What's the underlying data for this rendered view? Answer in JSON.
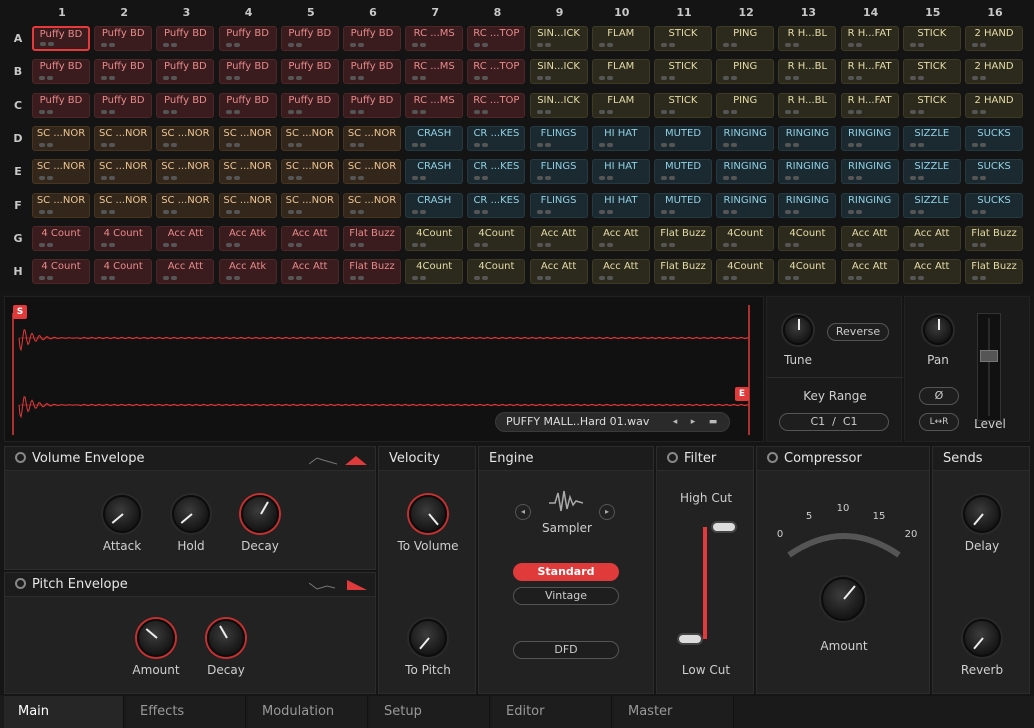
{
  "grid": {
    "columns": [
      "1",
      "2",
      "3",
      "4",
      "5",
      "6",
      "7",
      "8",
      "9",
      "10",
      "11",
      "12",
      "13",
      "14",
      "15",
      "16"
    ],
    "rows": [
      {
        "label": "A",
        "cells": [
          "Puffy BD",
          "Puffy BD",
          "Puffy BD",
          "Puffy BD",
          "Puffy BD",
          "Puffy BD",
          "RC ...MS",
          "RC ...TOP",
          "SIN...ICK",
          "FLAM",
          "STICK",
          "PING",
          "R H...BL",
          "R H...FAT",
          "STICK",
          "2 HAND"
        ]
      },
      {
        "label": "B",
        "cells": [
          "Puffy BD",
          "Puffy BD",
          "Puffy BD",
          "Puffy BD",
          "Puffy BD",
          "Puffy BD",
          "RC ...MS",
          "RC ...TOP",
          "SIN...ICK",
          "FLAM",
          "STICK",
          "PING",
          "R H...BL",
          "R H...FAT",
          "STICK",
          "2 HAND"
        ]
      },
      {
        "label": "C",
        "cells": [
          "Puffy BD",
          "Puffy BD",
          "Puffy BD",
          "Puffy BD",
          "Puffy BD",
          "Puffy BD",
          "RC ...MS",
          "RC ...TOP",
          "SIN...ICK",
          "FLAM",
          "STICK",
          "PING",
          "R H...BL",
          "R H...FAT",
          "STICK",
          "2 HAND"
        ]
      },
      {
        "label": "D",
        "cells": [
          "SC ...NOR",
          "SC ...NOR",
          "SC ...NOR",
          "SC ...NOR",
          "SC ...NOR",
          "SC ...NOR",
          "CRASH",
          "CR ...KES",
          "FLINGS",
          "HI HAT",
          "MUTED",
          "RINGING",
          "RINGING",
          "RINGING",
          "SIZZLE",
          "SUCKS"
        ]
      },
      {
        "label": "E",
        "cells": [
          "SC ...NOR",
          "SC ...NOR",
          "SC ...NOR",
          "SC ...NOR",
          "SC ...NOR",
          "SC ...NOR",
          "CRASH",
          "CR ...KES",
          "FLINGS",
          "HI HAT",
          "MUTED",
          "RINGING",
          "RINGING",
          "RINGING",
          "SIZZLE",
          "SUCKS"
        ]
      },
      {
        "label": "F",
        "cells": [
          "SC ...NOR",
          "SC ...NOR",
          "SC ...NOR",
          "SC ...NOR",
          "SC ...NOR",
          "SC ...NOR",
          "CRASH",
          "CR ...KES",
          "FLINGS",
          "HI HAT",
          "MUTED",
          "RINGING",
          "RINGING",
          "RINGING",
          "SIZZLE",
          "SUCKS"
        ]
      },
      {
        "label": "G",
        "cells": [
          "4 Count",
          "4 Count",
          "Acc Att",
          "Acc Atk",
          "Acc Att",
          "Flat Buzz",
          "4Count",
          "4Count",
          "Acc Att",
          "Acc Att",
          "Flat Buzz",
          "4Count",
          "4Count",
          "Acc Att",
          "Acc Att",
          "Flat Buzz"
        ]
      },
      {
        "label": "H",
        "cells": [
          "4 Count",
          "4 Count",
          "Acc Att",
          "Acc Atk",
          "Acc Att",
          "Flat Buzz",
          "4Count",
          "4Count",
          "Acc Att",
          "Acc Att",
          "Flat Buzz",
          "4Count",
          "4Count",
          "Acc Att",
          "Acc Att",
          "Flat Buzz"
        ]
      }
    ],
    "selected": {
      "row": 0,
      "col": 0
    }
  },
  "sample": {
    "start_marker": "S",
    "end_marker": "E",
    "file_name": "PUFFY MALL..Hard 01.wav",
    "prev_icon": "chevron-left-icon",
    "next_icon": "chevron-right-icon",
    "folder_icon": "folder-icon"
  },
  "tune": {
    "label": "Tune",
    "reverse_label": "Reverse",
    "key_range_label": "Key Range",
    "key_low": "C1",
    "key_sep": "/",
    "key_high": "C1"
  },
  "pan": {
    "pan_label": "Pan",
    "phase_symbol": "Ø",
    "swap_label": "L↔R",
    "level_label": "Level"
  },
  "volume_env": {
    "title": "Volume Envelope",
    "knobs": [
      "Attack",
      "Hold",
      "Decay"
    ]
  },
  "pitch_env": {
    "title": "Pitch Envelope",
    "knobs": [
      "Amount",
      "Decay"
    ]
  },
  "velocity": {
    "title": "Velocity",
    "to_volume": "To Volume",
    "to_pitch": "To Pitch"
  },
  "engine": {
    "title": "Engine",
    "mode": "Sampler",
    "options": [
      "Standard",
      "Vintage",
      "DFD"
    ],
    "active_option": "Standard"
  },
  "filter": {
    "title": "Filter",
    "high_cut": "High Cut",
    "low_cut": "Low Cut"
  },
  "compressor": {
    "title": "Compressor",
    "scale": [
      "0",
      "5",
      "10",
      "15",
      "20"
    ],
    "amount_label": "Amount"
  },
  "sends": {
    "title": "Sends",
    "delay": "Delay",
    "reverb": "Reverb"
  },
  "tabs": [
    "Main",
    "Effects",
    "Modulation",
    "Setup",
    "Editor",
    "Master"
  ],
  "active_tab": "Main",
  "colors": {
    "accent": "#e03a3a"
  }
}
